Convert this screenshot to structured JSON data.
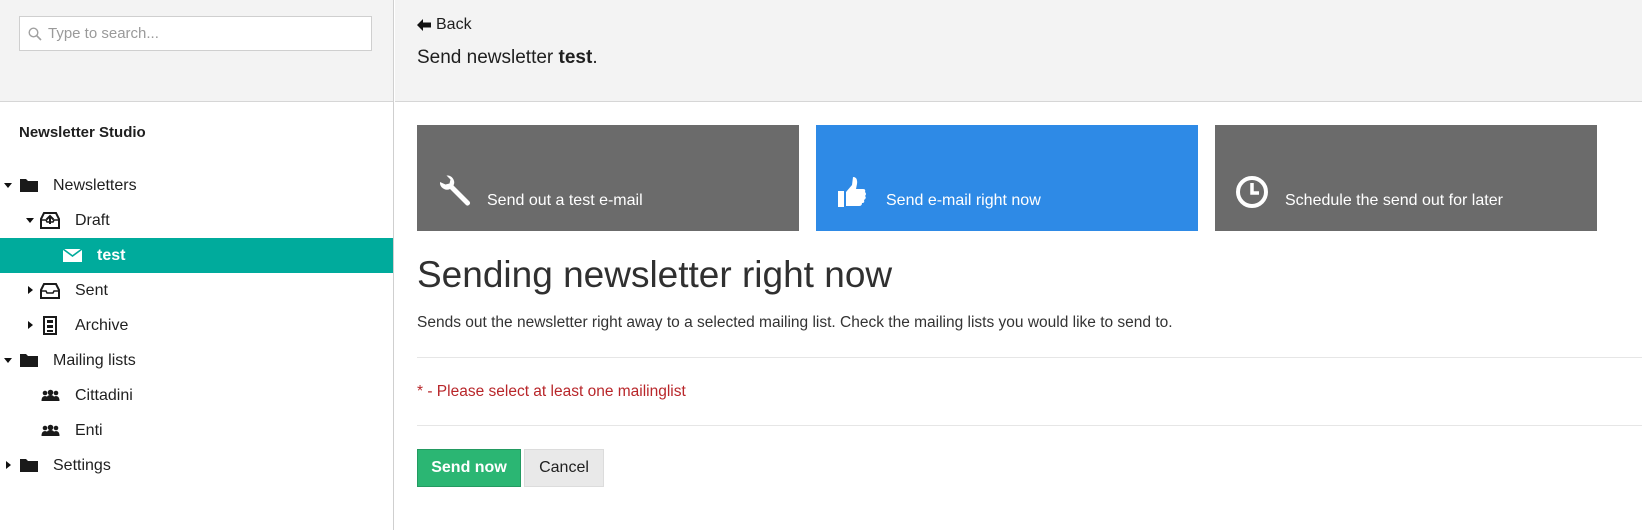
{
  "search": {
    "placeholder": "Type to search..."
  },
  "sidebar": {
    "title": "Newsletter Studio",
    "tree": {
      "newsletters": "Newsletters",
      "draft": "Draft",
      "test": "test",
      "sent": "Sent",
      "archive": "Archive",
      "mailing_lists": "Mailing lists",
      "cittadini": "Cittadini",
      "enti": "Enti",
      "settings": "Settings"
    }
  },
  "header": {
    "back_label": "Back",
    "title_prefix": "Send newsletter ",
    "title_name": "test",
    "title_suffix": "."
  },
  "tiles": [
    {
      "label": "Send out a test e-mail",
      "icon": "wrench-icon",
      "selected": false
    },
    {
      "label": "Send e-mail right now",
      "icon": "thumbs-up-icon",
      "selected": true
    },
    {
      "label": "Schedule the send out for later",
      "icon": "clock-icon",
      "selected": false
    }
  ],
  "content": {
    "heading": "Sending newsletter right now",
    "description": "Sends out the newsletter right away to a selected mailing list. Check the mailing lists you would like to send to.",
    "error": "* - Please select at least one mailinglist"
  },
  "buttons": {
    "send_now": "Send now",
    "cancel": "Cancel"
  },
  "colors": {
    "accent_teal": "#00ab9c",
    "tile_selected": "#2e8ae6",
    "tile_default": "#6b6b6b",
    "send_button": "#2bb673",
    "error": "#b8262a"
  }
}
